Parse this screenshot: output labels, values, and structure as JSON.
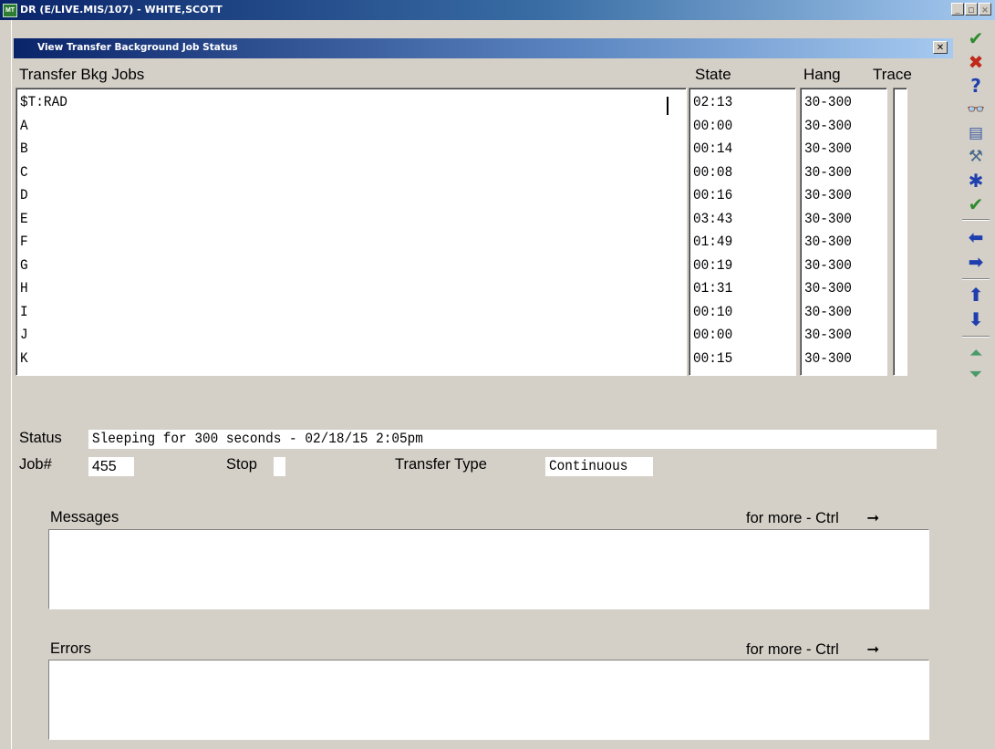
{
  "window": {
    "title": "DR (E/LIVE.MIS/107) - WHITE,SCOTT",
    "icon_label": "MT",
    "minimize": "_",
    "restore": "□",
    "close": "✕"
  },
  "dialog": {
    "title": "View Transfer Background Job Status",
    "close": "✕"
  },
  "table": {
    "headers": {
      "jobs": "Transfer Bkg Jobs",
      "state": "State",
      "hang": "Hang",
      "trace": "Trace"
    },
    "rows": [
      {
        "job": "$T:RAD",
        "state": "02:13",
        "hang": "30-300"
      },
      {
        "job": "A",
        "state": "00:00",
        "hang": "30-300"
      },
      {
        "job": "B",
        "state": "00:14",
        "hang": "30-300"
      },
      {
        "job": "C",
        "state": "00:08",
        "hang": "30-300"
      },
      {
        "job": "D",
        "state": "00:16",
        "hang": "30-300"
      },
      {
        "job": "E",
        "state": "03:43",
        "hang": "30-300"
      },
      {
        "job": "F",
        "state": "01:49",
        "hang": "30-300"
      },
      {
        "job": "G",
        "state": "00:19",
        "hang": "30-300"
      },
      {
        "job": "H",
        "state": "01:31",
        "hang": "30-300"
      },
      {
        "job": "I",
        "state": "00:10",
        "hang": "30-300"
      },
      {
        "job": "J",
        "state": "00:00",
        "hang": "30-300"
      },
      {
        "job": "K",
        "state": "00:15",
        "hang": "30-300"
      }
    ]
  },
  "status": {
    "label": "Status",
    "value": "Sleeping for 300 seconds - 02/18/15 2:05pm"
  },
  "job": {
    "label": "Job#",
    "value": "455",
    "stop_label": "Stop",
    "stop_value": "",
    "transfer_type_label": "Transfer Type",
    "transfer_type_value": "Continuous"
  },
  "messages": {
    "label": "Messages",
    "more": "for more - Ctrl",
    "more_arrow": "➞"
  },
  "errors": {
    "label": "Errors",
    "more": "for more - Ctrl",
    "more_arrow": "➞"
  },
  "toolbar": {
    "ok": "✔",
    "cancel": "✖",
    "help": "?",
    "find": "👓",
    "list": "▤",
    "tools": "⚒",
    "star": "✱",
    "ok_all": "✔",
    "left": "⬅",
    "right": "➡",
    "up": "⬆",
    "down": "⬇",
    "page_up": "⏶",
    "page_down": "⏷",
    "colors": {
      "ok": "#2e8b2e",
      "cancel": "#c0281a",
      "nav": "#1f3fae",
      "page": "#4a9a6a"
    }
  }
}
